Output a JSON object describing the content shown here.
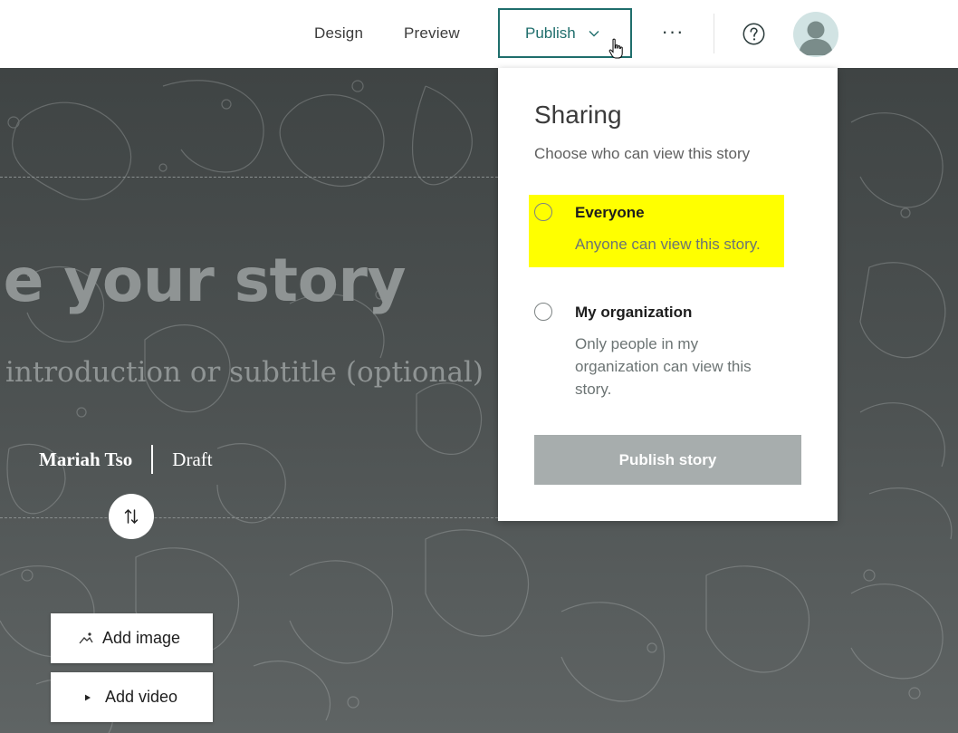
{
  "header": {
    "nav": {
      "design": "Design",
      "preview": "Preview"
    },
    "publish_label": "Publish",
    "more_label": "···"
  },
  "cover": {
    "title": "e your story",
    "subtitle": "introduction or subtitle (optional)",
    "author": "Mariah Tso",
    "status": "Draft",
    "media_buttons": {
      "add_image": "Add image",
      "add_video": "Add video"
    }
  },
  "sharing": {
    "title": "Sharing",
    "subtitle": "Choose who can view this story",
    "options": [
      {
        "label": "Everyone",
        "description": "Anyone can view this story."
      },
      {
        "label": "My organization",
        "description": "Only people in my organization can view this story."
      }
    ],
    "publish_story_label": "Publish story"
  },
  "colors": {
    "accent": "#1f6e6c",
    "highlight": "#ffff00",
    "disabled_button": "#a7adad"
  },
  "icons": {
    "publish_chevron": "chevron-down-icon",
    "help": "question-circle-icon",
    "avatar": "user-avatar-icon",
    "swap": "swap-vertical-icon",
    "add_image": "image-icon",
    "add_video": "play-icon"
  }
}
